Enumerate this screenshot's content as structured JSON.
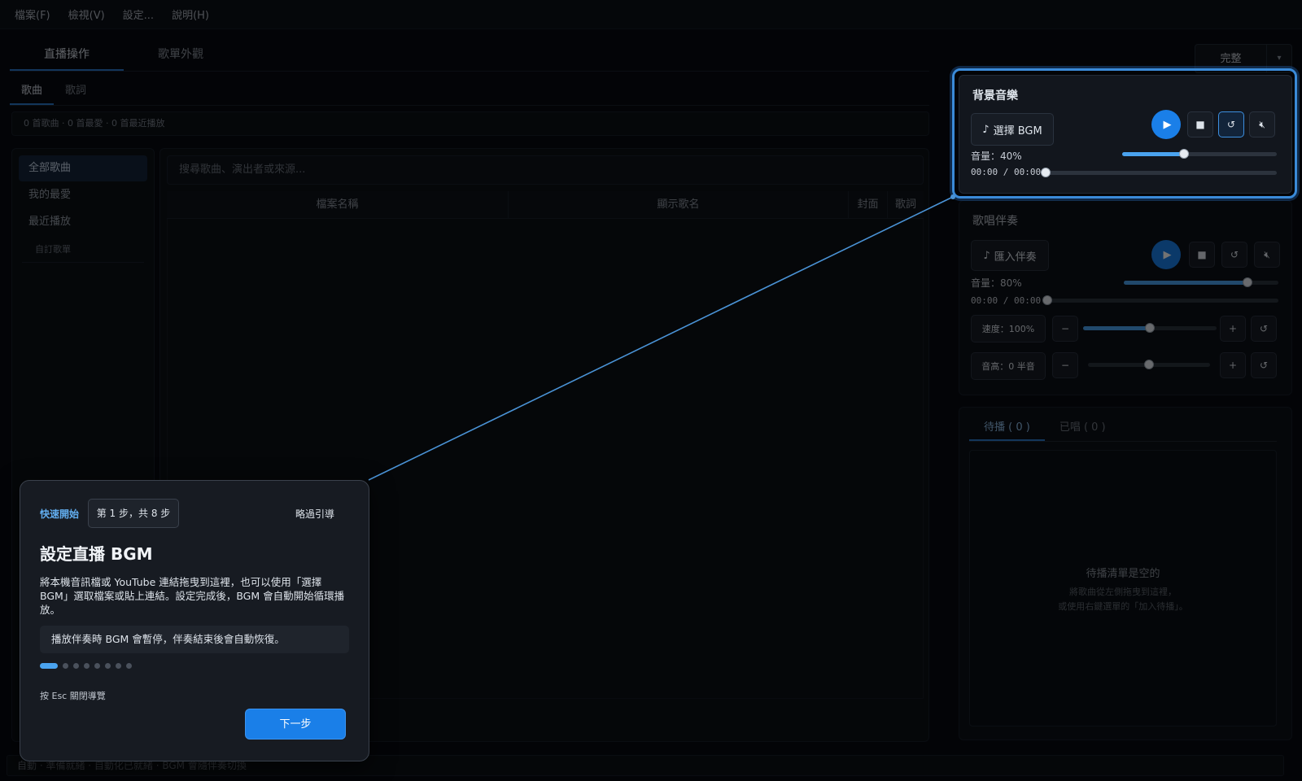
{
  "menu": [
    "檔案(F)",
    "檢視(V)",
    "設定...",
    "說明(H)"
  ],
  "main_tabs": [
    {
      "label": "直播操作",
      "active": true
    },
    {
      "label": "歌單外觀",
      "active": false
    }
  ],
  "mode": {
    "label": "完整"
  },
  "sub_tabs": [
    {
      "label": "歌曲",
      "active": true
    },
    {
      "label": "歌詞",
      "active": false
    }
  ],
  "stats": "0 首歌曲 · 0 首最愛 · 0 首最近播放",
  "library": {
    "items": [
      "全部歌曲",
      "我的最愛",
      "最近播放"
    ],
    "custom_section": "自訂歌單"
  },
  "songs": {
    "search_placeholder": "搜尋歌曲、演出者或來源...",
    "columns": [
      "檔案名稱",
      "顯示歌名",
      "封面",
      "歌詞"
    ]
  },
  "bgm": {
    "title": "背景音樂",
    "select_label": "選擇 BGM",
    "volume_label": "音量：40%",
    "volume": 0.4,
    "time": "00:00 / 00:00",
    "progress": 0,
    "loop_on": true
  },
  "karaoke": {
    "title": "歌唱伴奏",
    "import_label": "匯入伴奏",
    "volume_label": "音量：80%",
    "volume": 0.8,
    "time": "00:00 / 00:00",
    "progress": 0,
    "speed_label": "速度：100%",
    "speed": 0.5,
    "pitch_label": "音高：0 半音",
    "pitch": 0.5
  },
  "queue": {
    "tabs": [
      "待播 ( 0 )",
      "已唱 ( 0 )"
    ],
    "empty_title": "待播清單是空的",
    "empty_hint_1": "將歌曲從左側拖曳到這裡，",
    "empty_hint_2": "或使用右鍵選單的「加入待播」。"
  },
  "status": "自動 · 準備就緒 · 自動化已就緒 · BGM 會隨伴奏切換",
  "tour": {
    "kicker": "快速開始",
    "step": "第 1 步，共 8 步",
    "skip": "略過引導",
    "title": "設定直播 BGM",
    "body": "將本機音訊檔或 YouTube 連結拖曳到這裡，也可以使用「選擇 BGM」選取檔案或貼上連結。設定完成後，BGM 會自動開始循環播放。",
    "note": "播放伴奏時 BGM 會暫停，伴奏結束後會自動恢復。",
    "total_steps": 8,
    "current_step": 1,
    "esc_hint": "按 Esc 關閉導覽",
    "next_label": "下一步"
  },
  "colors": {
    "accent": "#1a7fe8",
    "highlight": "#3a8ad8",
    "background": "#080b10"
  }
}
